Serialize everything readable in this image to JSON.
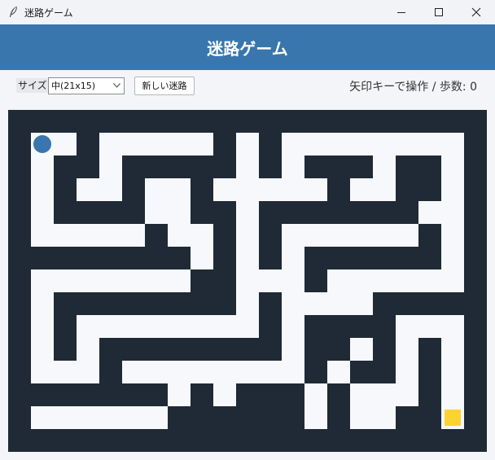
{
  "window": {
    "title": "迷路ゲーム"
  },
  "header": {
    "title": "迷路ゲーム"
  },
  "toolbar": {
    "size_label": "サイズ:",
    "size_selected": "中(21x15)",
    "new_maze_label": "新しい迷路",
    "status": "矢印キーで操作 / 歩数: 0"
  },
  "colors": {
    "wall": "#1f2a36",
    "path": "#f6f8fb",
    "player": "#3876ad",
    "goal": "#fdd332",
    "header": "#3876ad"
  },
  "icons": {
    "app": "feather-icon",
    "minimize": "minimize-icon",
    "maximize": "maximize-icon",
    "close": "close-icon"
  },
  "maze": {
    "cols": 21,
    "rows": 15,
    "player": [
      1,
      1
    ],
    "goal": [
      19,
      13
    ],
    "grid": [
      "111111111111111111111",
      "100100000101000000001",
      "101101111101011101101",
      "101001001000001001101",
      "101111001101111111001",
      "100000100101000000101",
      "111111110101011111101",
      "100000001100010000001",
      "101111111101000011111",
      "101000000001011110001",
      "101011111111011010101",
      "100010000000010110101",
      "111111101011101000101",
      "100000011111101001101",
      "111111111111111111111"
    ]
  }
}
